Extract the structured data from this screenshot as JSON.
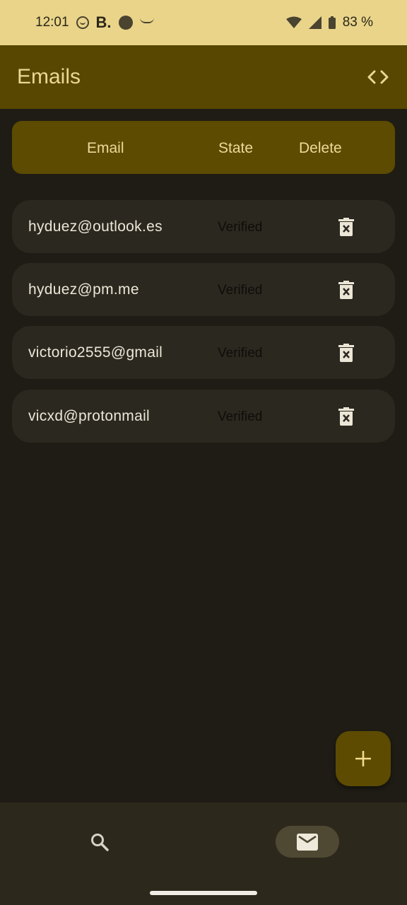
{
  "status_bar": {
    "time": "12:01",
    "b_label": "B.",
    "battery": "83 %"
  },
  "app_bar": {
    "title": "Emails",
    "code_icon": "code-icon"
  },
  "table_header": {
    "email": "Email",
    "state": "State",
    "delete": "Delete"
  },
  "emails": [
    {
      "address": "hyduez@outlook.es",
      "state": "Verified"
    },
    {
      "address": "hyduez@pm.me",
      "state": "Verified"
    },
    {
      "address": "victorio2555@gmail",
      "state": "Verified"
    },
    {
      "address": "vicxd@protonmail",
      "state": "Verified"
    }
  ],
  "fab": {
    "icon": "plus-icon"
  },
  "bottom_nav": {
    "items": [
      {
        "icon": "search-icon",
        "selected": false
      },
      {
        "icon": "mail-icon",
        "selected": true
      }
    ]
  },
  "colors": {
    "status_bar": "#e9d48a",
    "app_bar": "#574700",
    "background": "#1f1c15",
    "row": "#2b2820",
    "accent_text": "#ecd694"
  }
}
